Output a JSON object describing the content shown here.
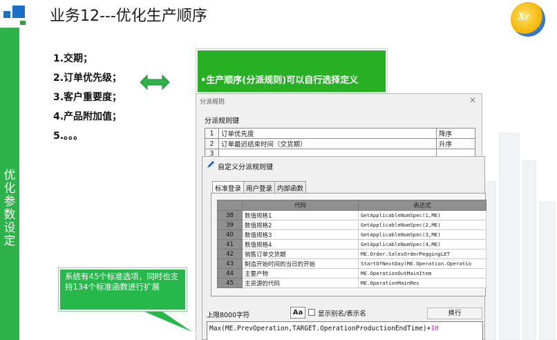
{
  "header": {
    "title": "业务12---优化生产顺序"
  },
  "sidebar": {
    "vertical_label": "优化参数设定"
  },
  "priority_list": [
    "1.交期；",
    "2.订单优先级；",
    "3.客户重要度；",
    "4.产品附加值；",
    "5.。。。"
  ],
  "highlight_box": {
    "text": "•生产顺序(分派规则)可以自行选择定义"
  },
  "dispatch_dialog": {
    "title": "分派规则",
    "close_icon": "close-icon",
    "section_label": "分派规则键",
    "rows": [
      {
        "num": "1",
        "key": "订单优先度",
        "order": "降序"
      },
      {
        "num": "2",
        "key": "订单最迟结束时间（交货期）",
        "order": "升序"
      },
      {
        "num": "3",
        "key": "",
        "order": ""
      }
    ]
  },
  "custom_dialog": {
    "title": "自定义分派规则键",
    "tabs": [
      "标准登录",
      "用户登录",
      "内部函数"
    ],
    "columns": [
      "代码",
      "表达式"
    ],
    "rows": [
      {
        "no": "38",
        "code": "数值规格1",
        "expr": "GetApplicableNumSpec(1,ME)"
      },
      {
        "no": "39",
        "code": "数值规格2",
        "expr": "GetApplicableNumSpec(2,ME)"
      },
      {
        "no": "40",
        "code": "数值规格3",
        "expr": "GetApplicableNumSpec(3,ME)"
      },
      {
        "no": "41",
        "code": "数值规格4",
        "expr": "GetApplicableNumSpec(4,ME)"
      },
      {
        "no": "42",
        "code": "销售订单交货期",
        "expr": "ME.Order.SalesOrderPeggingLET"
      },
      {
        "no": "43",
        "code": "制造开始时间的当日的开始",
        "expr": "StartOfNextDay(ME.Operation.Operatio"
      },
      {
        "no": "44",
        "code": "主要产物",
        "expr": "ME.OperationOutMainItem"
      },
      {
        "no": "45",
        "code": "主资源的代码",
        "expr": "ME.OperationMainRes"
      }
    ],
    "char_limit": "上限8000字符",
    "aa_label": "Aa",
    "show_alias_label": "显示别名/表示名",
    "wrap_button": "换行",
    "formula_main": "Max(ME.PrevOperation,TARGET.OperationProductionEndTime)+",
    "formula_highlight": "1H"
  },
  "callout": {
    "text": "系统有45个标准选项，同时也支持134个标准函数进行扩展"
  },
  "colors": {
    "accent_green": "#27b024",
    "brand_blue": "#1b6fc9",
    "formula_highlight": "#c42bd1"
  }
}
